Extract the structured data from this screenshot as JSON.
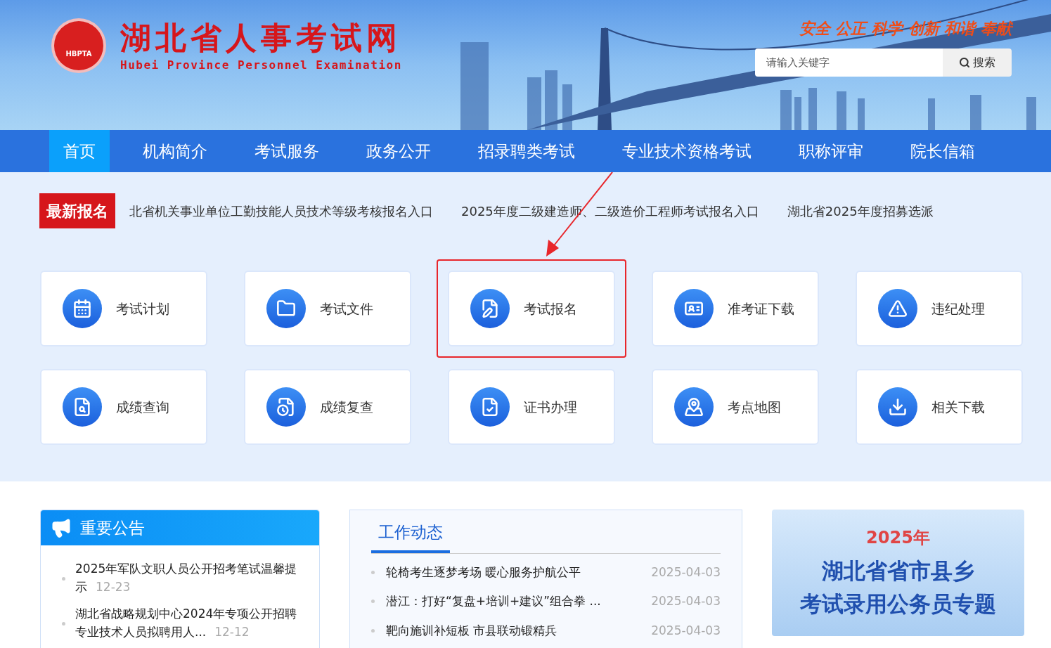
{
  "header": {
    "logo_text": "HBPTA",
    "site_title": "湖北省人事考试网",
    "site_subtitle": "Hubei Province Personnel Examination",
    "slogan": "安全 公正 科学 创新 和谐 奉献",
    "search": {
      "placeholder": "请输入关键字",
      "button": "搜索"
    }
  },
  "nav": [
    {
      "label": "首页",
      "selected": true
    },
    {
      "label": "机构简介",
      "selected": false
    },
    {
      "label": "考试服务",
      "selected": false
    },
    {
      "label": "政务公开",
      "selected": false
    },
    {
      "label": "招录聘类考试",
      "selected": false
    },
    {
      "label": "专业技术资格考试",
      "selected": false
    },
    {
      "label": "职称评审",
      "selected": false
    },
    {
      "label": "院长信箱",
      "selected": false
    }
  ],
  "ticker": {
    "badge": "最新报名",
    "items": [
      "北省机关事业单位工勤技能人员技术等级考核报名入口",
      "2025年度二级建造师、二级造价工程师考试报名入口",
      "湖北省2025年度招募选派"
    ]
  },
  "tiles": [
    {
      "label": "考试计划",
      "kind": "calendar",
      "highlighted": false
    },
    {
      "label": "考试文件",
      "kind": "folder",
      "highlighted": false
    },
    {
      "label": "考试报名",
      "kind": "form",
      "highlighted": true
    },
    {
      "label": "准考证下载",
      "kind": "card",
      "highlighted": false
    },
    {
      "label": "违纪处理",
      "kind": "warning",
      "highlighted": false
    },
    {
      "label": "成绩查询",
      "kind": "search",
      "highlighted": false
    },
    {
      "label": "成绩复查",
      "kind": "recheck",
      "highlighted": false
    },
    {
      "label": "证书办理",
      "kind": "certificate",
      "highlighted": false
    },
    {
      "label": "考点地图",
      "kind": "map",
      "highlighted": false
    },
    {
      "label": "相关下载",
      "kind": "download",
      "highlighted": false
    }
  ],
  "notices": {
    "title": "重要公告",
    "items": [
      {
        "title": "2025年军队文职人员公开招考笔试温馨提示",
        "date": "12-23"
      },
      {
        "title": "湖北省战略规划中心2024年专项公开招聘专业技术人员拟聘用人...",
        "date": "12-12"
      }
    ]
  },
  "news": {
    "title": "工作动态",
    "items": [
      {
        "title": "轮椅考生逐梦考场 暖心服务护航公平",
        "date": "2025-04-03"
      },
      {
        "title": "潜江：打好“复盘+培训+建议”组合拳 ...",
        "date": "2025-04-03"
      },
      {
        "title": "靶向施训补短板 市县联动锻精兵",
        "date": "2025-04-03"
      }
    ]
  },
  "banner": {
    "year": "2025年",
    "line1": "湖北省省市县乡",
    "line2": "考试录用公务员专题"
  }
}
